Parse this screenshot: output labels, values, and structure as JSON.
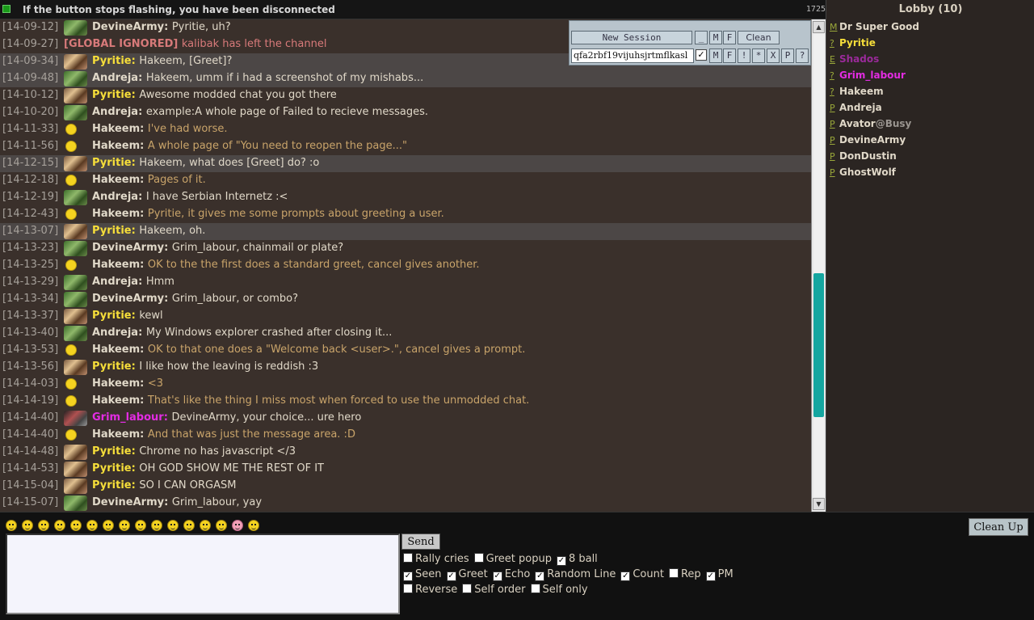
{
  "topbar": {
    "message": "If the button stops flashing, you have been disconnected",
    "count": "1725"
  },
  "session": {
    "new_session": "New Session",
    "min": "_",
    "m": "M",
    "f": "F",
    "clean": "Clean",
    "input_value": "qfa2rbf19vijuhsjrtmflkasl",
    "check": "✓",
    "ex": "!",
    "star": "*",
    "x": "X",
    "p": "P",
    "q": "?"
  },
  "chat": [
    {
      "ts": "[14-09-12]",
      "av": "ork",
      "name": "DevineArmy",
      "nc": "c-devine",
      "text": "Pyritie, uh?",
      "tc": "t-std",
      "hl": false
    },
    {
      "ts": "[14-09-27]",
      "av": "none",
      "name": "[GLOBAL IGNORED]",
      "nc": "c-global",
      "text": "kalibak has left the channel",
      "tc": "t-red",
      "hl": false
    },
    {
      "ts": "[14-09-34]",
      "av": "pir",
      "name": "Pyritie",
      "nc": "c-pyritie",
      "text": "Hakeem, [Greet]?",
      "tc": "t-std",
      "hl": true
    },
    {
      "ts": "[14-09-48]",
      "av": "ork",
      "name": "Andreja",
      "nc": "c-andreja",
      "text": "Hakeem, umm if i had a screenshot of my mishabs...",
      "tc": "t-std",
      "hl": true
    },
    {
      "ts": "[14-10-12]",
      "av": "pir",
      "name": "Pyritie",
      "nc": "c-pyritie",
      "text": "Awesome modded chat you got there",
      "tc": "t-std",
      "hl": false
    },
    {
      "ts": "[14-10-20]",
      "av": "ork",
      "name": "Andreja",
      "nc": "c-andreja",
      "text": "example:A whole page of Failed to recieve messages.",
      "tc": "t-std",
      "hl": false
    },
    {
      "ts": "[14-11-33]",
      "av": "smile",
      "name": "Hakeem",
      "nc": "c-hakeem",
      "text": "I've had worse.",
      "tc": "t-hak",
      "hl": false
    },
    {
      "ts": "[14-11-56]",
      "av": "smile",
      "name": "Hakeem",
      "nc": "c-hakeem",
      "text": "A whole page of \"You need to reopen the page...\"",
      "tc": "t-hak",
      "hl": false
    },
    {
      "ts": "[14-12-15]",
      "av": "pir",
      "name": "Pyritie",
      "nc": "c-pyritie",
      "text": "Hakeem, what does [Greet] do? :o",
      "tc": "t-std",
      "hl": true
    },
    {
      "ts": "[14-12-18]",
      "av": "smile",
      "name": "Hakeem",
      "nc": "c-hakeem",
      "text": "Pages of it.",
      "tc": "t-hak",
      "hl": false
    },
    {
      "ts": "[14-12-19]",
      "av": "ork",
      "name": "Andreja",
      "nc": "c-andreja",
      "text": "I have Serbian Internetz :<",
      "tc": "t-std",
      "hl": false
    },
    {
      "ts": "[14-12-43]",
      "av": "smile",
      "name": "Hakeem",
      "nc": "c-hakeem",
      "text": "Pyritie, it gives me some prompts about greeting a user.",
      "tc": "t-hak",
      "hl": false
    },
    {
      "ts": "[14-13-07]",
      "av": "pir",
      "name": "Pyritie",
      "nc": "c-pyritie",
      "text": "Hakeem, oh.",
      "tc": "t-std",
      "hl": true
    },
    {
      "ts": "[14-13-23]",
      "av": "ork",
      "name": "DevineArmy",
      "nc": "c-devine",
      "text": "Grim_labour, chainmail or plate?",
      "tc": "t-std",
      "hl": false
    },
    {
      "ts": "[14-13-25]",
      "av": "smile",
      "name": "Hakeem",
      "nc": "c-hakeem",
      "text": "OK to the the first does a standard greet, cancel gives another.",
      "tc": "t-hak",
      "hl": false
    },
    {
      "ts": "[14-13-29]",
      "av": "ork",
      "name": "Andreja",
      "nc": "c-andreja",
      "text": "Hmm",
      "tc": "t-std",
      "hl": false
    },
    {
      "ts": "[14-13-34]",
      "av": "ork",
      "name": "DevineArmy",
      "nc": "c-devine",
      "text": "Grim_labour, or combo?",
      "tc": "t-std",
      "hl": false
    },
    {
      "ts": "[14-13-37]",
      "av": "pir",
      "name": "Pyritie",
      "nc": "c-pyritie",
      "text": "kewl",
      "tc": "t-std",
      "hl": false
    },
    {
      "ts": "[14-13-40]",
      "av": "ork",
      "name": "Andreja",
      "nc": "c-andreja",
      "text": "My Windows explorer crashed after closing it...",
      "tc": "t-std",
      "hl": false
    },
    {
      "ts": "[14-13-53]",
      "av": "smile",
      "name": "Hakeem",
      "nc": "c-hakeem",
      "text": "OK to that one does a \"Welcome back <user>.\", cancel gives a prompt.",
      "tc": "t-hak",
      "hl": false
    },
    {
      "ts": "[14-13-56]",
      "av": "pir",
      "name": "Pyritie",
      "nc": "c-pyritie",
      "text": "I like how the leaving is reddish :3",
      "tc": "t-std",
      "hl": false
    },
    {
      "ts": "[14-14-03]",
      "av": "smile",
      "name": "Hakeem",
      "nc": "c-hakeem",
      "text": "<3",
      "tc": "t-hak",
      "hl": false
    },
    {
      "ts": "[14-14-19]",
      "av": "smile",
      "name": "Hakeem",
      "nc": "c-hakeem",
      "text": "That's like the thing I miss most when forced to use the unmodded chat.",
      "tc": "t-hak",
      "hl": false
    },
    {
      "ts": "[14-14-40]",
      "av": "grim",
      "name": "Grim_labour",
      "nc": "c-grim",
      "text": "DevineArmy, your choice... ure hero",
      "tc": "t-std",
      "hl": false
    },
    {
      "ts": "[14-14-40]",
      "av": "smile",
      "name": "Hakeem",
      "nc": "c-hakeem",
      "text": "And that was just the message area. :D",
      "tc": "t-hak",
      "hl": false
    },
    {
      "ts": "[14-14-48]",
      "av": "pir",
      "name": "Pyritie",
      "nc": "c-pyritie",
      "text": "Chrome no has javascript </3",
      "tc": "t-std",
      "hl": false
    },
    {
      "ts": "[14-14-53]",
      "av": "pir",
      "name": "Pyritie",
      "nc": "c-pyritie",
      "text": "OH GOD SHOW ME THE REST OF IT",
      "tc": "t-std",
      "hl": false
    },
    {
      "ts": "[14-15-04]",
      "av": "pir",
      "name": "Pyritie",
      "nc": "c-pyritie",
      "text": "SO I CAN ORGASM",
      "tc": "t-std",
      "hl": false
    },
    {
      "ts": "[14-15-07]",
      "av": "ork",
      "name": "DevineArmy",
      "nc": "c-devine",
      "text": "Grim_labour, yay",
      "tc": "t-std",
      "hl": false
    }
  ],
  "scroll": {
    "position": 0.75
  },
  "lobby": {
    "title": "Lobby (10)",
    "users": [
      {
        "rank": "M",
        "name": "Dr Super Good",
        "color": "#e0d8c8",
        "status": ""
      },
      {
        "rank": "?",
        "name": "Pyritie",
        "color": "#f6de3a",
        "status": ""
      },
      {
        "rank": "E",
        "name": "Shados",
        "color": "#9a2a9a",
        "status": ""
      },
      {
        "rank": "?",
        "name": "Grim_labour",
        "color": "#e22ce2",
        "status": ""
      },
      {
        "rank": "?",
        "name": "Hakeem",
        "color": "#e0d8c8",
        "status": ""
      },
      {
        "rank": "P",
        "name": "Andreja",
        "color": "#e0d8c8",
        "status": ""
      },
      {
        "rank": "P",
        "name": "Avator",
        "color": "#e0d8c8",
        "status": "@Busy"
      },
      {
        "rank": "P",
        "name": "DevineArmy",
        "color": "#e0d8c8",
        "status": ""
      },
      {
        "rank": "P",
        "name": "DonDustin",
        "color": "#e0d8c8",
        "status": ""
      },
      {
        "rank": "P",
        "name": "GhostWolf",
        "color": "#e0d8c8",
        "status": ""
      }
    ]
  },
  "composer": {
    "send": "Send",
    "cleanup": "Clean Up",
    "smiley_count": 16,
    "options": [
      [
        {
          "label": "Rally cries",
          "checked": false
        },
        {
          "label": "Greet popup",
          "checked": false
        },
        {
          "label": "8 ball",
          "checked": true
        }
      ],
      [
        {
          "label": "Seen",
          "checked": true
        },
        {
          "label": "Greet",
          "checked": true
        },
        {
          "label": "Echo",
          "checked": true
        },
        {
          "label": "Random Line",
          "checked": true
        },
        {
          "label": "Count",
          "checked": true
        },
        {
          "label": "Rep",
          "checked": false
        },
        {
          "label": "PM",
          "checked": true
        }
      ],
      [
        {
          "label": "Reverse",
          "checked": false
        },
        {
          "label": "Self order",
          "checked": false
        },
        {
          "label": "Self only",
          "checked": false
        }
      ]
    ]
  }
}
